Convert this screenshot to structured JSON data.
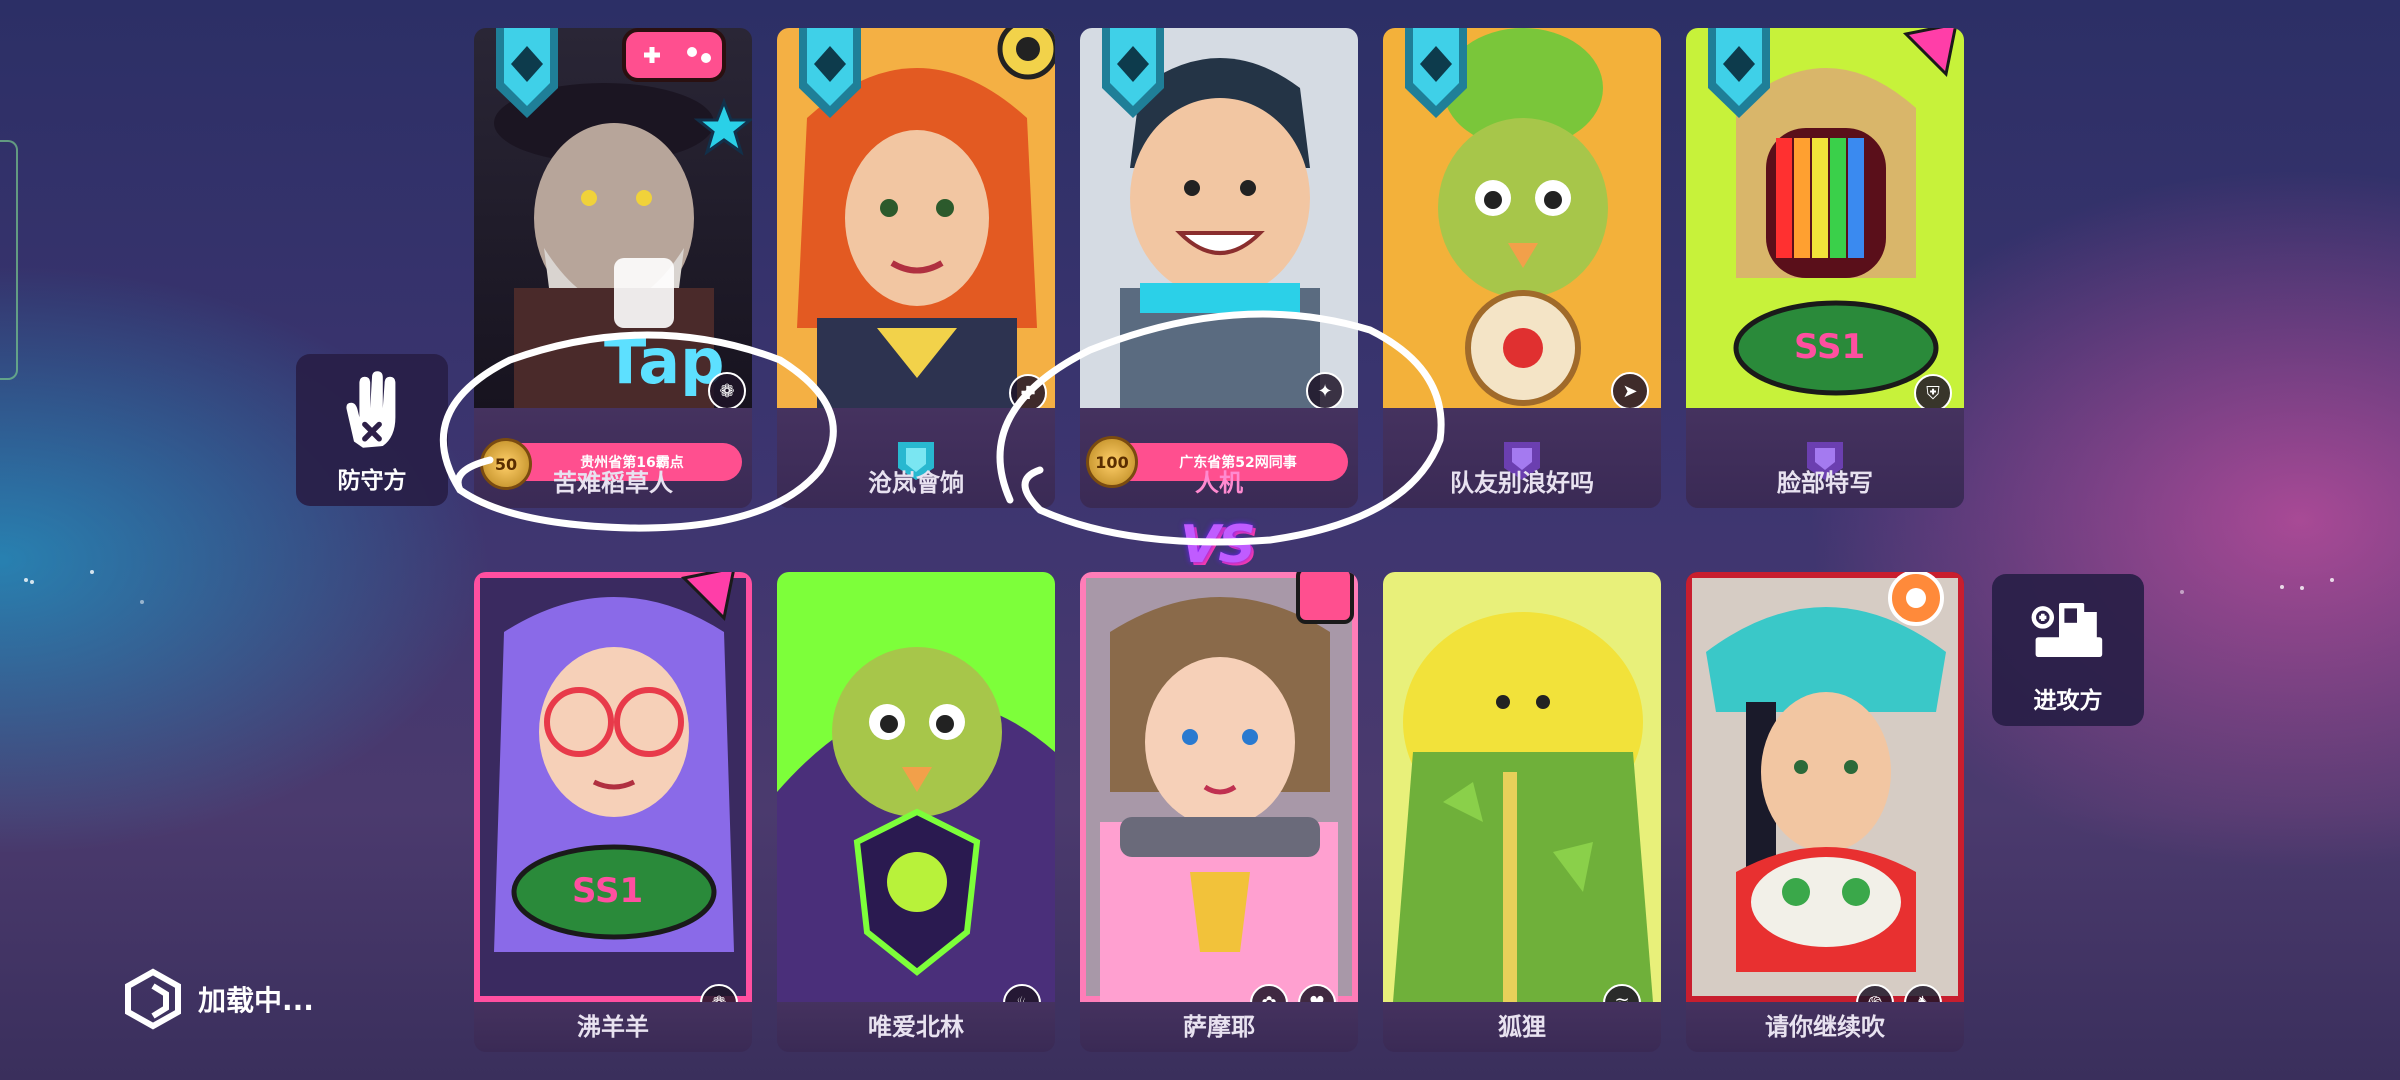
{
  "defender_button": {
    "label": "防守方"
  },
  "attacker_button": {
    "label": "进攻方"
  },
  "vs_label": "VS",
  "loading_text": "加载中...",
  "tap_label": "Tap",
  "top_team": [
    {
      "name": "苦难稻草人",
      "medal": "50",
      "title": "贵州省第16霸点",
      "highlight": false,
      "colors": [
        "#2b2a3a",
        "#e8a23c"
      ]
    },
    {
      "name": "沧岚會饷",
      "highlight": false,
      "emblem": "cyan-shield",
      "colors": [
        "#f2a03a",
        "#e35a22"
      ]
    },
    {
      "name": "人机",
      "medal": "100",
      "title": "广东省第52网同事",
      "highlight": true,
      "colors": [
        "#cfd6df",
        "#5a6b80"
      ]
    },
    {
      "name": "队友别浪好吗",
      "highlight": false,
      "emblem": "purple-shield",
      "colors": [
        "#f3b13a",
        "#a7c64a"
      ]
    },
    {
      "name": "脸部特写",
      "highlight": false,
      "emblem": "purple-shield",
      "colors": [
        "#c7f23a",
        "#ff4fa0"
      ]
    }
  ],
  "bottom_team": [
    {
      "name": "沸羊羊",
      "colors": [
        "#b28cff",
        "#ff4fa0"
      ]
    },
    {
      "name": "唯爱北林",
      "colors": [
        "#7dff3a",
        "#4a2f7a"
      ]
    },
    {
      "name": "萨摩耶",
      "colors": [
        "#ff7db8",
        "#ffa0d0"
      ]
    },
    {
      "name": "狐狸",
      "colors": [
        "#e8f07a",
        "#5fa83a"
      ]
    },
    {
      "name": "请你继续吹",
      "colors": [
        "#3ac8c8",
        "#c81e2e"
      ]
    }
  ],
  "accent_colors": {
    "pink": "#ff4f8f",
    "purple": "#6b3fb0",
    "gold": "#f0b04a"
  }
}
